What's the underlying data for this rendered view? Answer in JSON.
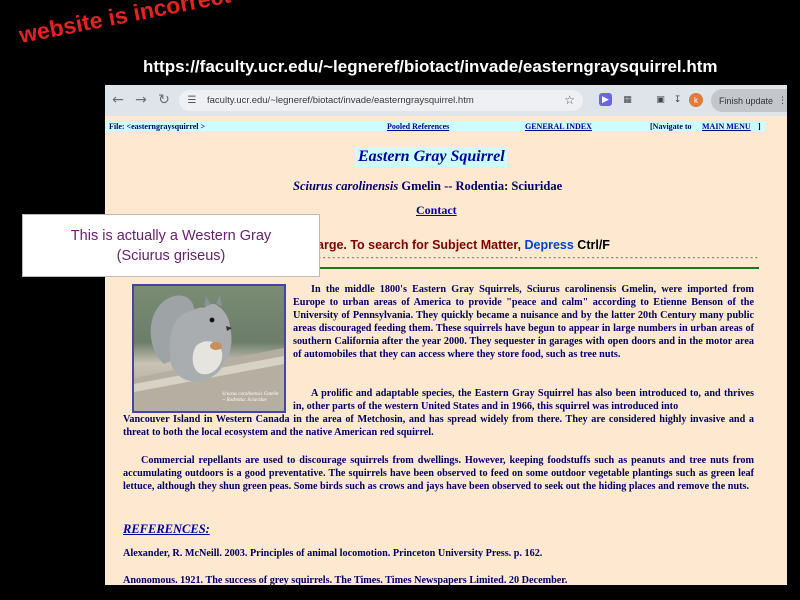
{
  "annotations": {
    "incorrect_note": "website is incorrect",
    "url_note": "https://faculty.ucr.edu/~legneref/biotact/invade/easterngraysquirrel.htm",
    "callout_line1": "This is actually a Western Gray",
    "callout_line2": "(Sciurus griseus)"
  },
  "browser": {
    "url": "faculty.ucr.edu/~legneref/biotact/invade/easterngraysquirrel.htm",
    "avatar_letter": "k",
    "finish_update_label": "Finish update",
    "icons": {
      "back": "back-arrow-icon",
      "forward": "forward-arrow-icon",
      "reload": "reload-icon",
      "star": "star-icon",
      "menu": "more-vert-icon"
    }
  },
  "page": {
    "topnav": {
      "file_label": "File:  <easterngraysquirrel >",
      "pooled": "Pooled References",
      "general": "GENERAL INDEX",
      "navigate_prefix": "[Navigate to",
      "main_menu": "MAIN MENU",
      "navigate_suffix": "]"
    },
    "title": "Eastern Gray Squirrel",
    "sci_name": "Sciurus carolinensis",
    "sci_rest": " Gmelin -- Rodentia:  Sciuridae",
    "contact": "Contact",
    "search_prefix": "arge.  To search for Subject Matter, ",
    "search_depress": "Depress",
    "search_key": " Ctrl/F",
    "dashes": "--------------------------------------------------------------------------------------------------------------------------------------------------------------------------------",
    "photo_caption": "Sciurus carolinensis Gmelin -- Rodentia: Sciuridae",
    "para1": "In the middle 1800's Eastern Gray Squirrels, Sciurus carolinensis Gmelin, were imported from Europe to urban areas of America to provide \"peace and calm\" according to Etienne Benson of the University of Pennsylvania.  They quickly became a nuisance and by the latter 20th Century many public areas discouraged feeding them.  These squirrels have begun to appear in large numbers in urban areas of southern California after the year 2000.  They sequester in garages with open doors and in the motor area of automobiles that they can access where they store food, such as tree nuts.",
    "para2a": "A prolific and adaptable species, the Eastern Gray Squirrel has also been introduced to, and thrives in, other parts of the western United States and in 1966, this squirrel was introduced into",
    "para2b": "Vancouver Island in Western Canada in the area of Metchosin, and has spread widely from there.  They are considered highly invasive and a threat to both the local ecosystem and the native American red squirrel.",
    "para3": "Commercial repellants are used to discourage squirrels from dwellings.  However, keeping foodstuffs such as peanuts and tree nuts from accumulating outdoors is a good preventative.  The squirrels have been observed to feed on some outdoor vegetable plantings such as green leaf lettuce, although they shun green peas.  Some birds such as crows and jays have been observed to seek out the hiding places and remove the nuts.",
    "references_heading": "REFERENCES:",
    "ref1": "Alexander, R. McNeill.  2003.  Principles of animal locomotion.  Princeton University Press. p. 162.",
    "ref2": "Anonomous.  1921.  The success of grey squirrels.  The Times. Times Newspapers Limited. 20 December."
  }
}
